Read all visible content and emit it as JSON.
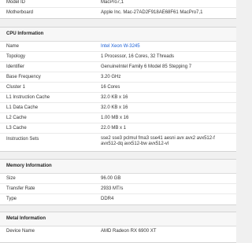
{
  "top": {
    "rows": [
      {
        "label": "Model ID",
        "value": "MacPro7,1"
      },
      {
        "label": "Motherboard",
        "value": "Apple Inc. Mac-27AD2F918AE68F61 MacPro7,1"
      }
    ]
  },
  "cpu": {
    "title": "CPU Information",
    "rows": [
      {
        "label": "Name",
        "value": "Intel Xeon W-3245"
      },
      {
        "label": "Topology",
        "value": "1 Processor, 16 Cores, 32 Threads"
      },
      {
        "label": "Identifier",
        "value": "GenuineIntel Family 6 Model 85 Stepping 7"
      },
      {
        "label": "Base Frequency",
        "value": "3.20 GHz"
      },
      {
        "label": "Cluster 1",
        "value": "16 Cores"
      },
      {
        "label": "L1 Instruction Cache",
        "value": "32.0 KB x 16"
      },
      {
        "label": "L1 Data Cache",
        "value": "32.0 KB x 16"
      },
      {
        "label": "L2 Cache",
        "value": "1.00 MB x 16"
      },
      {
        "label": "L3 Cache",
        "value": "22.0 MB x 1"
      },
      {
        "label": "Instruction Sets",
        "value": "sse2 sse3 pclmul fma3 sse41 aesni avx avx2 avx512-f avx512-dq avx512-bw avx512-vl"
      }
    ]
  },
  "memory": {
    "title": "Memory Information",
    "rows": [
      {
        "label": "Size",
        "value": "96.00 GB"
      },
      {
        "label": "Transfer Rate",
        "value": "2933 MT/s"
      },
      {
        "label": "Type",
        "value": "DDR4"
      }
    ]
  },
  "metal": {
    "title": "Metal Information",
    "rows": [
      {
        "label": "Device Name",
        "value": "AMD Radeon RX 6900 XT"
      }
    ]
  },
  "colors": {
    "link": "#1a5fd6",
    "background": "#f0f0f0"
  }
}
